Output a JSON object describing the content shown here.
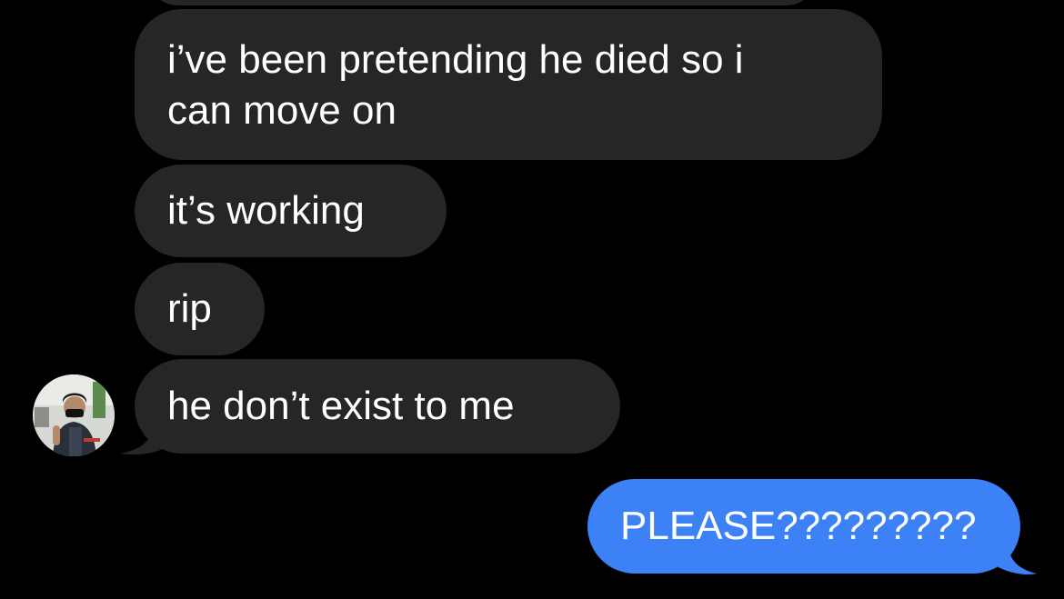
{
  "conversation": {
    "incoming_messages": [
      {
        "text_line1": "i’ve been pretending he died so i",
        "text_line2": "can move on"
      },
      {
        "text": "it’s working"
      },
      {
        "text": "rip"
      },
      {
        "text": "he don’t exist to me"
      }
    ],
    "outgoing_messages": [
      {
        "text": "PLEASE?????????"
      }
    ]
  },
  "colors": {
    "background": "#000000",
    "incoming_bubble": "#262629",
    "outgoing_bubble": "#3c82f6",
    "text": "#ffffff"
  },
  "icons": {
    "contact_avatar": "contact-avatar-photo"
  }
}
